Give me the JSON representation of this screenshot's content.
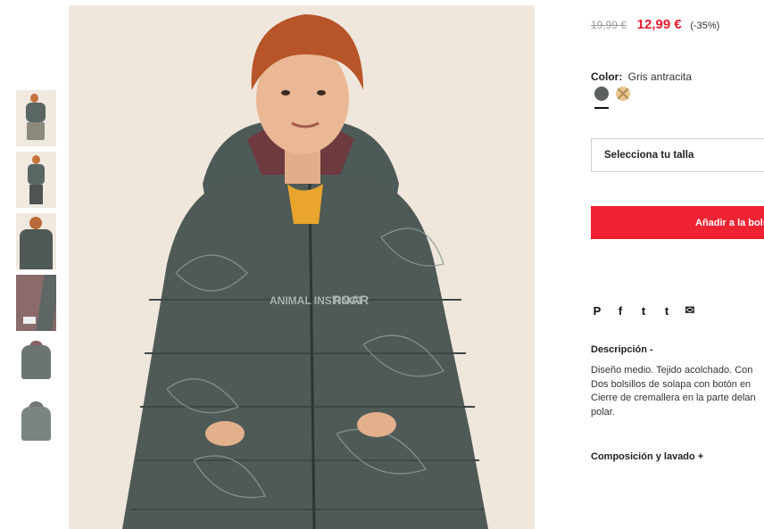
{
  "thumbnails": [
    {
      "alt": "thumbnail-1"
    },
    {
      "alt": "thumbnail-2"
    },
    {
      "alt": "thumbnail-3"
    },
    {
      "alt": "thumbnail-4"
    },
    {
      "alt": "thumbnail-5"
    },
    {
      "alt": "thumbnail-6"
    }
  ],
  "product": {
    "old_price": "19,99 €",
    "new_price": "12,99 €",
    "discount": "(-35%)",
    "color_label": "Color:",
    "color_value": "Gris antracita",
    "swatch_colors": [
      "#5b5f5f",
      "#e9c68e"
    ],
    "size_placeholder": "Selecciona tu talla",
    "add_button": "Añadir a la bolsa",
    "image_print_text_1": "ANIMAL INSTINCT",
    "image_print_text_2": "ROAR"
  },
  "share": {
    "pinterest": "P",
    "facebook": "f",
    "twitter": "t",
    "tumblr": "t",
    "email": "✉"
  },
  "description": {
    "title": "Descripción -",
    "lines": [
      "Diseño medio. Tejido acolchado. Con",
      "Dos bolsillos de solapa con botón en",
      "Cierre de cremallera en la parte delan",
      "polar."
    ]
  },
  "composition": {
    "title": "Composición y lavado +"
  },
  "colors": {
    "accent_red": "#ee2232",
    "price_red": "#e51b2d"
  }
}
